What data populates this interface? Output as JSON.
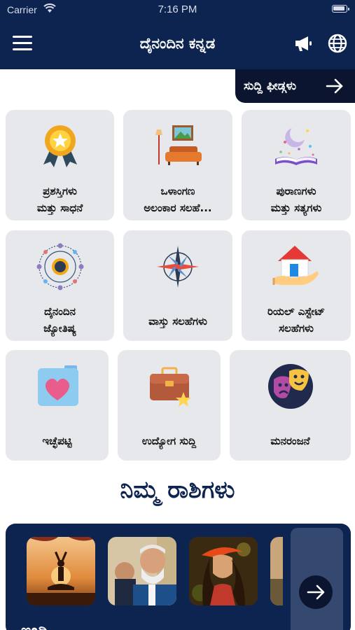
{
  "status_bar": {
    "carrier": "Carrier",
    "time": "7:16 PM"
  },
  "header": {
    "title": "ದೈನಂದಿನ ಕನ್ನಡ",
    "menu_icon": "hamburger-menu-icon",
    "announce_icon": "megaphone-icon",
    "language_icon": "globe-icon"
  },
  "news_button": {
    "label": "ಸುದ್ದಿ ಫೀಡ್ಗಳು",
    "icon": "arrow-right-icon"
  },
  "tiles": [
    {
      "line1": "ಪ್ರಶಸ್ತಿಗಳು",
      "line2": "ಮತ್ತು ಸಾಧನೆ",
      "icon": "award-medal-icon"
    },
    {
      "line1": "ಒಳಾಂಗಣ",
      "line2": "ಅಲಂಕಾರ ಸಲಹೆ...",
      "icon": "sofa-lamp-icon"
    },
    {
      "line1": "ಪುರಾಣಗಳು",
      "line2": "ಮತ್ತು ಸತ್ಯಗಳು",
      "icon": "magic-book-icon"
    },
    {
      "line1": "ದೈನಂದಿನ",
      "line2": "ಜ್ಯೋತಿಷ್ಯ",
      "icon": "astrology-sun-icon"
    },
    {
      "line1": "ವಾಸ್ತು ಸಲಹೆಗಳು",
      "icon": "compass-rose-icon"
    },
    {
      "line1": "ರಿಯಲ್ ಎಸ್ಟೇಟ್",
      "line2": "ಸಲಹೆಗಳು",
      "icon": "house-hand-icon"
    },
    {
      "line1": "ಇಚ್ಛೆಪಟ್ಟಿ",
      "icon": "heart-folder-icon"
    },
    {
      "line1": "ಉದ್ಯೋಗ ಸುದ್ದಿ",
      "icon": "briefcase-star-icon"
    },
    {
      "line1": "ಮನರಂಜನೆ",
      "icon": "theater-masks-icon"
    }
  ],
  "rashi_section": {
    "title": "ನಿಮ್ಮ ರಾಶಿಗಳು",
    "next_icon": "arrow-right-circle-icon",
    "partial_text": "ಇಂದಿ",
    "thumbnails": [
      "yoga-sunset-photo",
      "politician-photo",
      "woman-portrait-photo",
      "partial-photo"
    ]
  },
  "colors": {
    "navy": "#0d2350",
    "tile_bg": "#e6e8ec",
    "news_bg": "#0b1530"
  }
}
